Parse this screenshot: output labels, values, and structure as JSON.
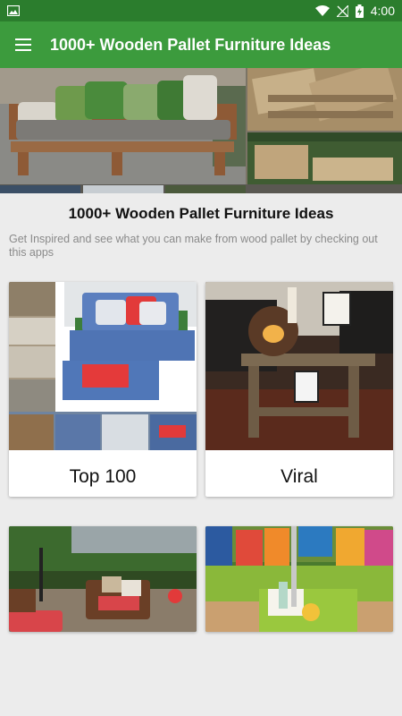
{
  "status_bar": {
    "time": "4:00"
  },
  "app_bar": {
    "title": "1000+ Wooden Pallet Furniture Ideas"
  },
  "hero": {
    "image_name": "pallet-furniture-collage"
  },
  "intro": {
    "heading": "1000+ Wooden Pallet Furniture Ideas",
    "description": "Get Inspired and see what you can make from wood pallet by checking out this apps"
  },
  "categories": [
    {
      "label": "Top 100"
    },
    {
      "label": "Viral"
    },
    {
      "label": ""
    },
    {
      "label": ""
    }
  ],
  "colors": {
    "primary": "#3c9b3d",
    "primary_dark": "#2b7d2d",
    "background": "#ececec"
  }
}
